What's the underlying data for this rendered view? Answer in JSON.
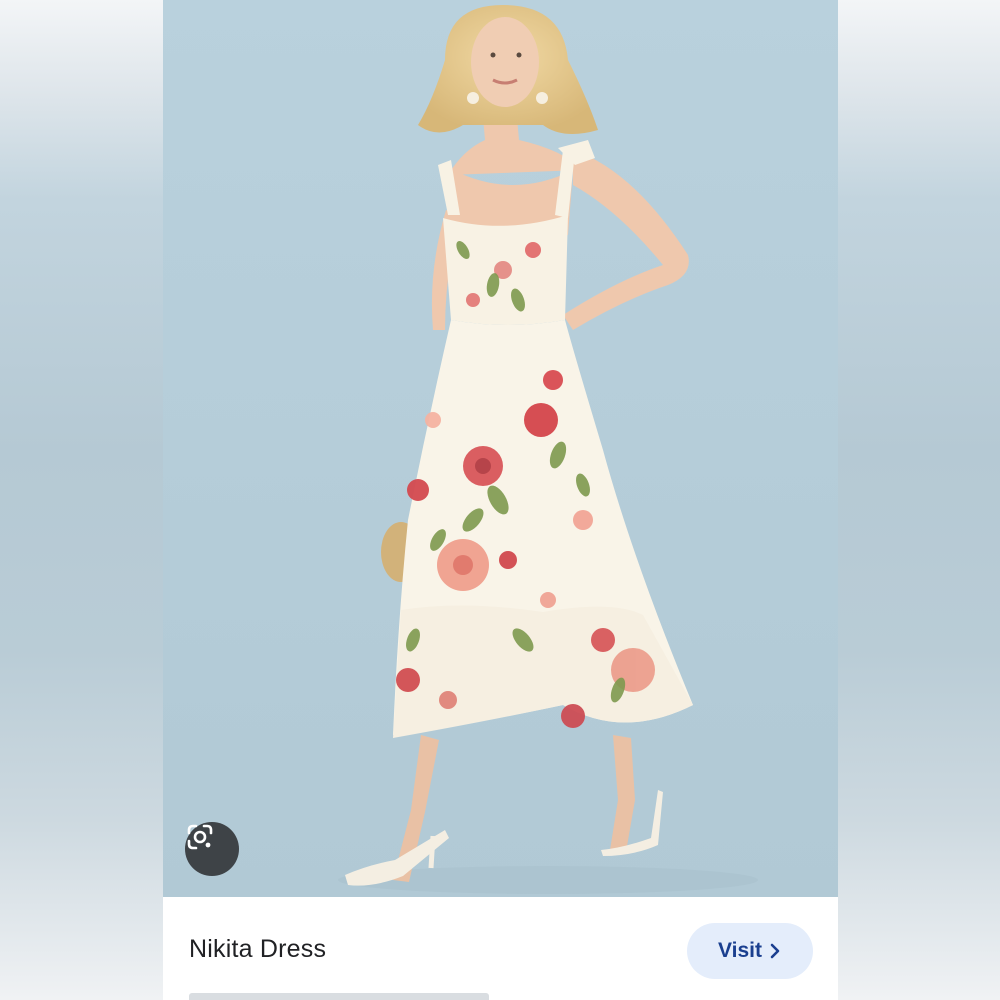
{
  "result": {
    "title": "Nikita Dress",
    "visit_label": "Visit"
  },
  "icons": {
    "lens": "google-lens-icon",
    "chevron": "chevron-right-icon"
  },
  "colors": {
    "photo_background": "#b7cfdb",
    "visit_button_bg": "#e4edfb",
    "visit_text": "#1a3f8f",
    "lens_button_bg": "#3e4347"
  }
}
